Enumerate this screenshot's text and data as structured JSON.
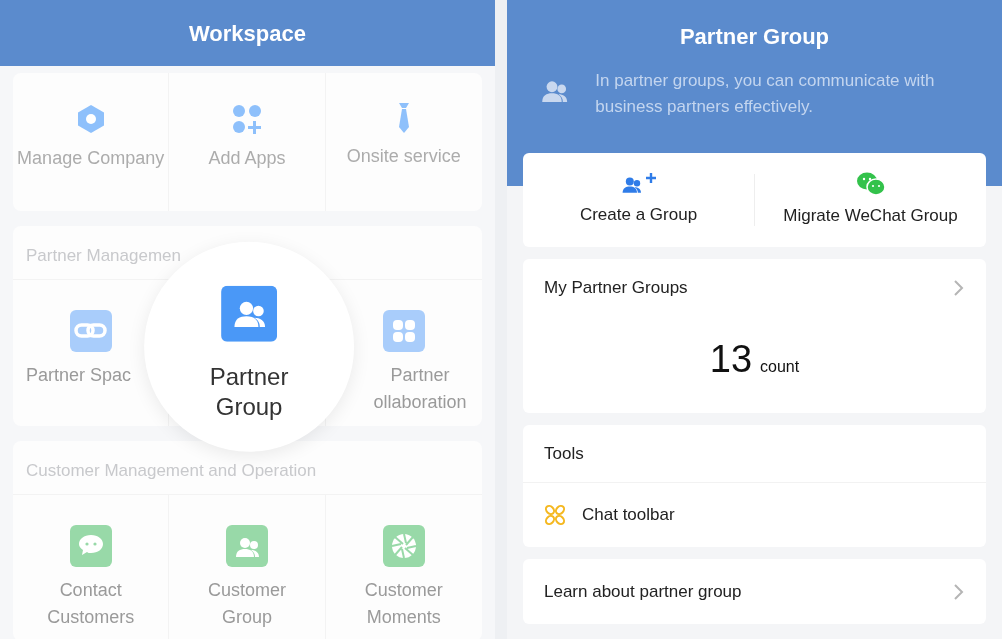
{
  "workspace": {
    "title": "Workspace",
    "sections": [
      {
        "kind": "plain",
        "apps": [
          {
            "kind": "app",
            "label": "Manage Company"
          },
          {
            "kind": "app",
            "label": "Add Apps"
          },
          {
            "kind": "app",
            "label": "Onsite service"
          }
        ]
      },
      {
        "kind": "blue",
        "heading": "Partner Managemen",
        "apps": [
          {
            "kind": "app",
            "label": "Partner Spac"
          },
          {
            "kind": "magnified",
            "label": "Partner Group"
          },
          {
            "kind": "app",
            "label": "Partner ollaboration"
          }
        ]
      },
      {
        "kind": "green",
        "heading": "Customer Management and Operation",
        "apps": [
          {
            "kind": "app",
            "label": "Contact Customers"
          },
          {
            "kind": "app",
            "label": "Customer Group"
          },
          {
            "kind": "app",
            "label": "Customer Moments"
          }
        ]
      }
    ]
  },
  "partner_group": {
    "title": "Partner Group",
    "description": "In partner groups, you can communicate with business partners effectively.",
    "actions": [
      {
        "label": "Create a Group"
      },
      {
        "label": "Migrate WeChat Group"
      }
    ],
    "my_groups": {
      "title": "My Partner Groups",
      "count": "13",
      "unit": "count"
    },
    "tools": {
      "title": "Tools",
      "items": [
        {
          "label": "Chat toolbar"
        }
      ]
    },
    "learn": {
      "label": "Learn about partner group"
    }
  }
}
